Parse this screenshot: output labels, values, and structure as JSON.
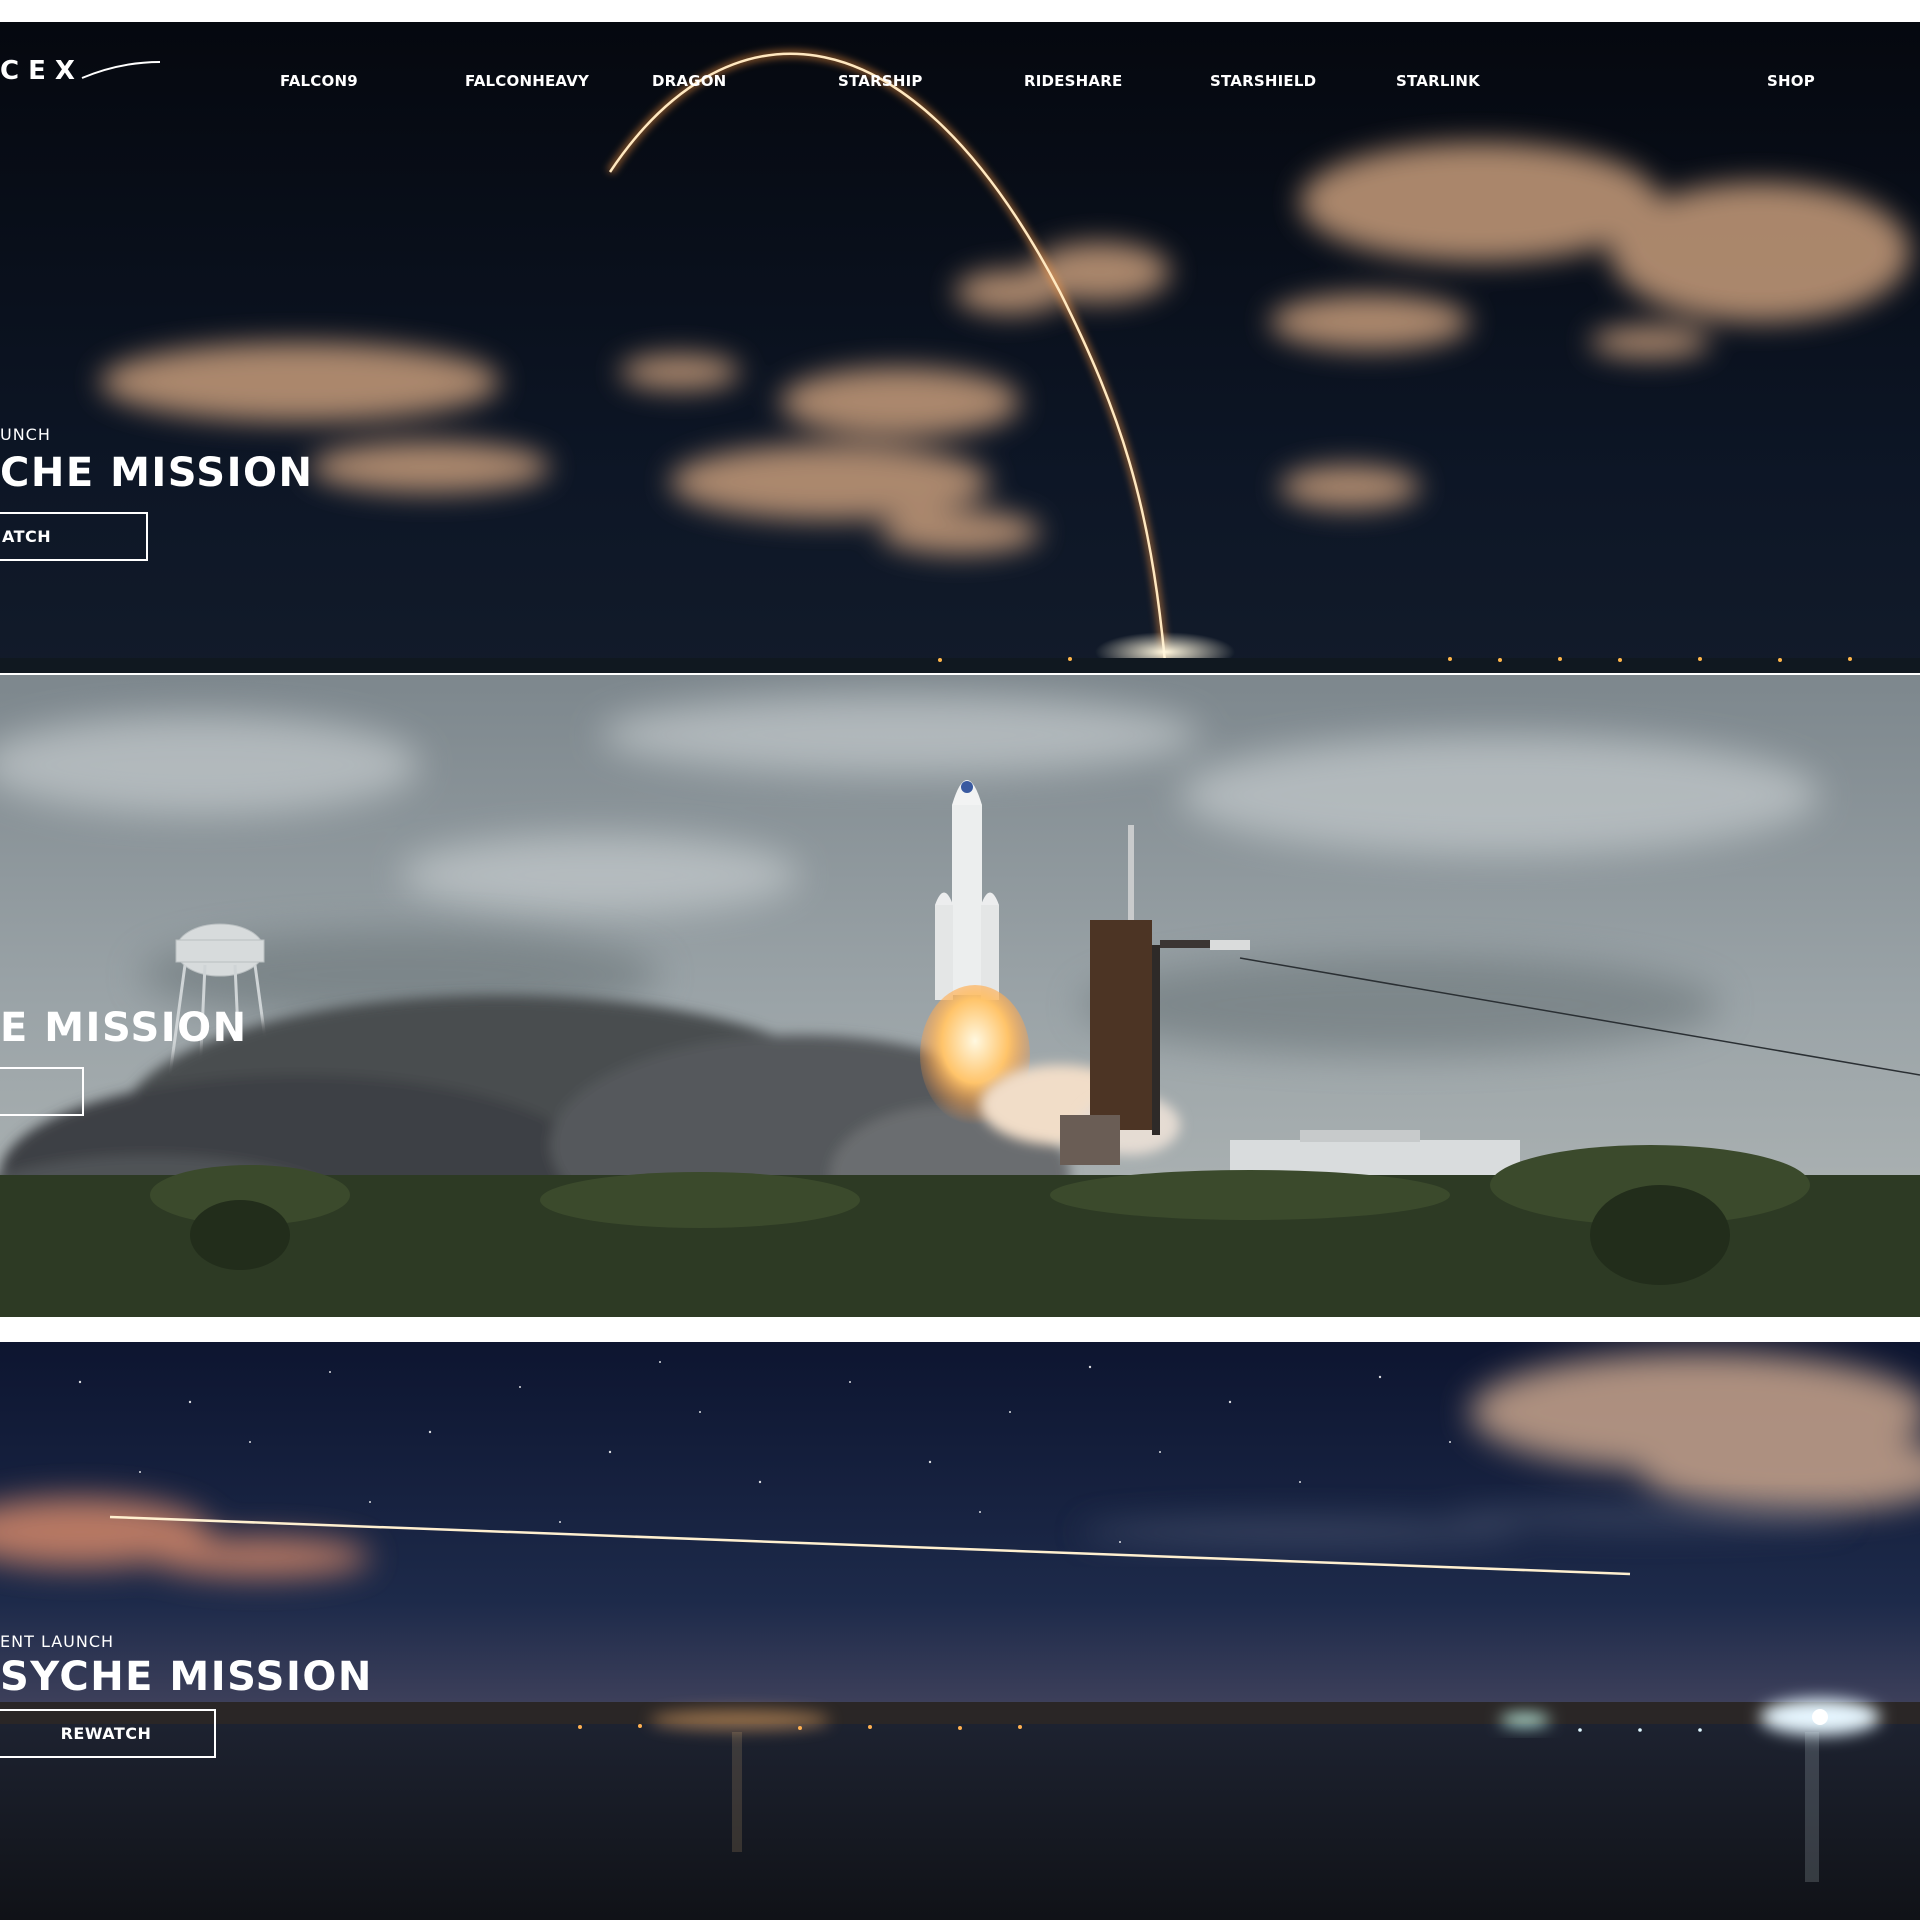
{
  "header": {
    "logo_text": "CEX",
    "nav_items": [
      {
        "label": "FALCON9",
        "id": "falcon9"
      },
      {
        "label": "FALCONHEAVY",
        "id": "falconheavy"
      },
      {
        "label": "DRAGON",
        "id": "dragon"
      },
      {
        "label": "STARSHIP",
        "id": "starship"
      },
      {
        "label": "RIDESHARE",
        "id": "rideshare"
      },
      {
        "label": "STARSHIELD",
        "id": "starshield"
      },
      {
        "label": "STARLINK",
        "id": "starlink"
      }
    ],
    "shop_label": "SHOP"
  },
  "slides": [
    {
      "eyebrow": "UNCH",
      "title": "CHE MISSION",
      "button": "ATCH"
    },
    {
      "eyebrow": "",
      "title": "E MISSION",
      "button": ""
    },
    {
      "eyebrow": "ENT LAUNCH",
      "title": "SYCHE MISSION",
      "button": "REWATCH"
    }
  ],
  "colors": {
    "text": "#ffffff",
    "page_background": "#ffffff",
    "night_sky": "#0b1322",
    "overcast_sky": "#8c959a",
    "dusk_sky": "#1c2540"
  }
}
